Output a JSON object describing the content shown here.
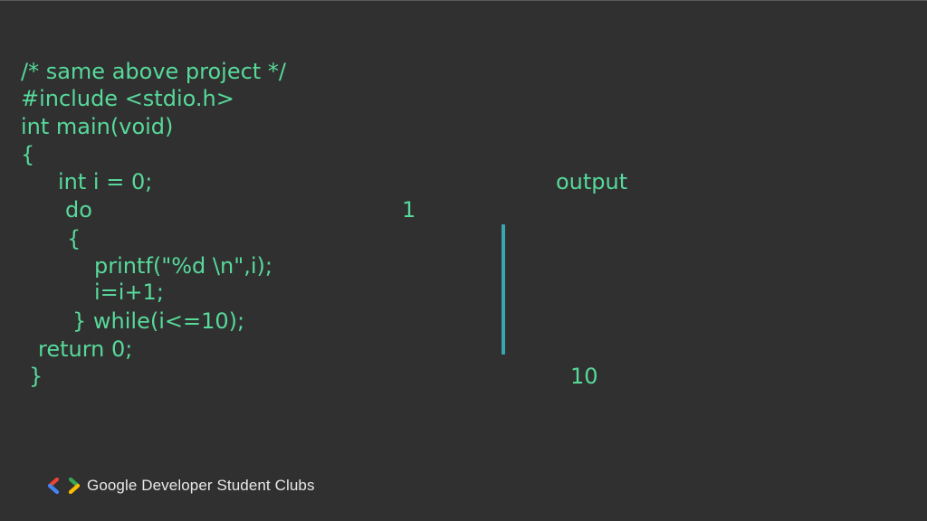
{
  "code": {
    "lines": [
      "/* same above project */",
      "#include <stdio.h>",
      "int main(void)",
      "{",
      "int i = 0;",
      "do",
      "{",
      "printf(\"%d \\n\",i);",
      "i=i+1;",
      "} while(i<=10);",
      "return 0;",
      "}"
    ]
  },
  "output": {
    "label": "output",
    "first_value": "1",
    "last_value": "10"
  },
  "footer": {
    "brand_text": "Google Developer Student Clubs",
    "logo_icon": "gdsc-logo-icon"
  },
  "colors": {
    "background": "#303030",
    "code_text": "#57d99a",
    "bar": "#3aa6b0",
    "footer_text": "#e8e8e8"
  }
}
